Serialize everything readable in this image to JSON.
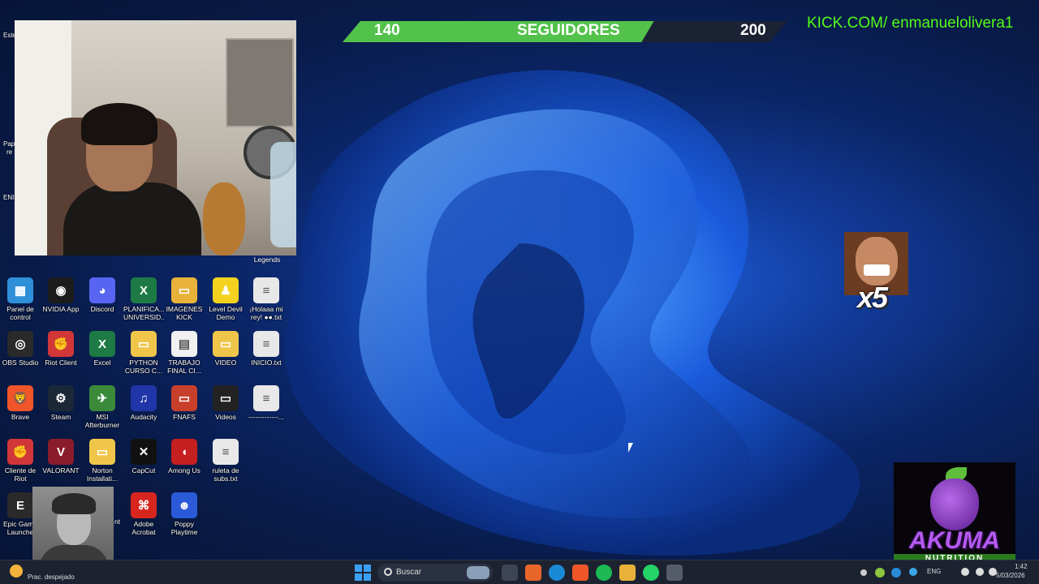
{
  "overlay": {
    "followers_current": "140",
    "followers_label": "SEGUIDORES",
    "followers_goal": "200",
    "follower_progress": 0.7,
    "kick_url": "KICK.COM/ enmanuelolivera1",
    "emote_multiplier": "x5",
    "sponsor_name": "AKUMA",
    "sponsor_sub": "NUTRITION"
  },
  "desktop": {
    "top_label": "Legends",
    "left_edge_labels": [
      "Este",
      "Pap",
      "re",
      "ENI"
    ],
    "icons": [
      {
        "label": "Panel de\ncontrol",
        "icon": "control-panel-icon",
        "color": "#2f8fd8",
        "glyph": "▦"
      },
      {
        "label": "NVIDIA App",
        "icon": "nvidia-icon",
        "color": "#1c1c1c",
        "glyph": "◉"
      },
      {
        "label": "Discord",
        "icon": "discord-icon",
        "color": "#5865f2",
        "glyph": "◕"
      },
      {
        "label": "PLANIFICA...\nUNIVERSID...",
        "icon": "excel-file-icon",
        "color": "#1d7a44",
        "glyph": "X"
      },
      {
        "label": "IMAGENES\nKICK",
        "icon": "folder-icon",
        "color": "#e8b23a",
        "glyph": "▭"
      },
      {
        "label": "Level Devil\nDemo",
        "icon": "level-devil-icon",
        "color": "#f2d21c",
        "glyph": "♟"
      },
      {
        "label": "¡Holaaa mi\nrey! ●●.txt",
        "icon": "text-file-icon",
        "color": "#e8e8e8",
        "glyph": "≡"
      },
      {
        "label": "OBS Studio",
        "icon": "obs-icon",
        "color": "#2a2a2a",
        "glyph": "◎"
      },
      {
        "label": "Riot Client",
        "icon": "riot-icon",
        "color": "#d13639",
        "glyph": "✊"
      },
      {
        "label": "Excel",
        "icon": "excel-icon",
        "color": "#1d7a44",
        "glyph": "X"
      },
      {
        "label": "PYTHON\nCURSO C...",
        "icon": "folder-icon",
        "color": "#f0c64a",
        "glyph": "▭"
      },
      {
        "label": "TRABAJO\nFINAL CI...",
        "icon": "document-icon",
        "color": "#f1f1f1",
        "glyph": "▤"
      },
      {
        "label": "VIDEO",
        "icon": "folder-icon",
        "color": "#f0c64a",
        "glyph": "▭"
      },
      {
        "label": "INICIO.txt",
        "icon": "text-file-icon",
        "color": "#e8e8e8",
        "glyph": "≡"
      },
      {
        "label": "Brave",
        "icon": "brave-icon",
        "color": "#f0562a",
        "glyph": "🦁"
      },
      {
        "label": "Steam",
        "icon": "steam-icon",
        "color": "#1b2838",
        "glyph": "⚙"
      },
      {
        "label": "MSI\nAfterburner",
        "icon": "msi-icon",
        "color": "#3a8a3a",
        "glyph": "✈"
      },
      {
        "label": "Audacity",
        "icon": "audacity-icon",
        "color": "#2036a8",
        "glyph": "♫"
      },
      {
        "label": "FNAFS",
        "icon": "folder-icon",
        "color": "#c8402c",
        "glyph": "▭"
      },
      {
        "label": "Videos",
        "icon": "folder-icon",
        "color": "#222222",
        "glyph": "▭"
      },
      {
        "label": "-------------...",
        "icon": "text-file-icon",
        "color": "#e8e8e8",
        "glyph": "≡"
      },
      {
        "label": "Cliente de\nRiot",
        "icon": "riot-icon",
        "color": "#d13639",
        "glyph": "✊"
      },
      {
        "label": "VALORANT",
        "icon": "valorant-icon",
        "color": "#8a1c2c",
        "glyph": "V"
      },
      {
        "label": "Norton\nInstallati...",
        "icon": "folder-icon",
        "color": "#f0c64a",
        "glyph": "▭"
      },
      {
        "label": "CapCut",
        "icon": "capcut-icon",
        "color": "#111111",
        "glyph": "✕"
      },
      {
        "label": "Among Us",
        "icon": "among-us-icon",
        "color": "#c51f1f",
        "glyph": "◖"
      },
      {
        "label": "ruleta de\nsubs.txt",
        "icon": "text-file-icon",
        "color": "#e8e8e8",
        "glyph": "≡"
      },
      {
        "label": "Epic Game\nLaunche",
        "icon": "epic-games-icon",
        "color": "#2a2a2a",
        "glyph": "E"
      },
      {
        "label": "Adobe\nAcrobat",
        "icon": "acrobat-icon",
        "color": "#d8261f",
        "glyph": "⌘"
      },
      {
        "label": "Poppy\nPlaytime",
        "icon": "poppy-playtime-icon",
        "color": "#2a5ad8",
        "glyph": "☻"
      }
    ],
    "partial_label": "nt"
  },
  "taskbar": {
    "weather_text": "Prac. despejado",
    "search_placeholder": "Buscar",
    "language": "ENG",
    "time": "1:42",
    "date": "5/03/2026",
    "apps": [
      {
        "name": "task-view-icon",
        "color": "#3c4456"
      },
      {
        "name": "store-icon",
        "color": "#e8662a"
      },
      {
        "name": "edge-icon",
        "color": "#1b8ad6"
      },
      {
        "name": "brave-icon",
        "color": "#f0562a"
      },
      {
        "name": "spotify-icon",
        "color": "#1db954"
      },
      {
        "name": "file-explorer-icon",
        "color": "#e8b23a"
      },
      {
        "name": "whatsapp-icon",
        "color": "#25d366"
      },
      {
        "name": "obs-icon",
        "color": "#555c6a"
      }
    ]
  }
}
